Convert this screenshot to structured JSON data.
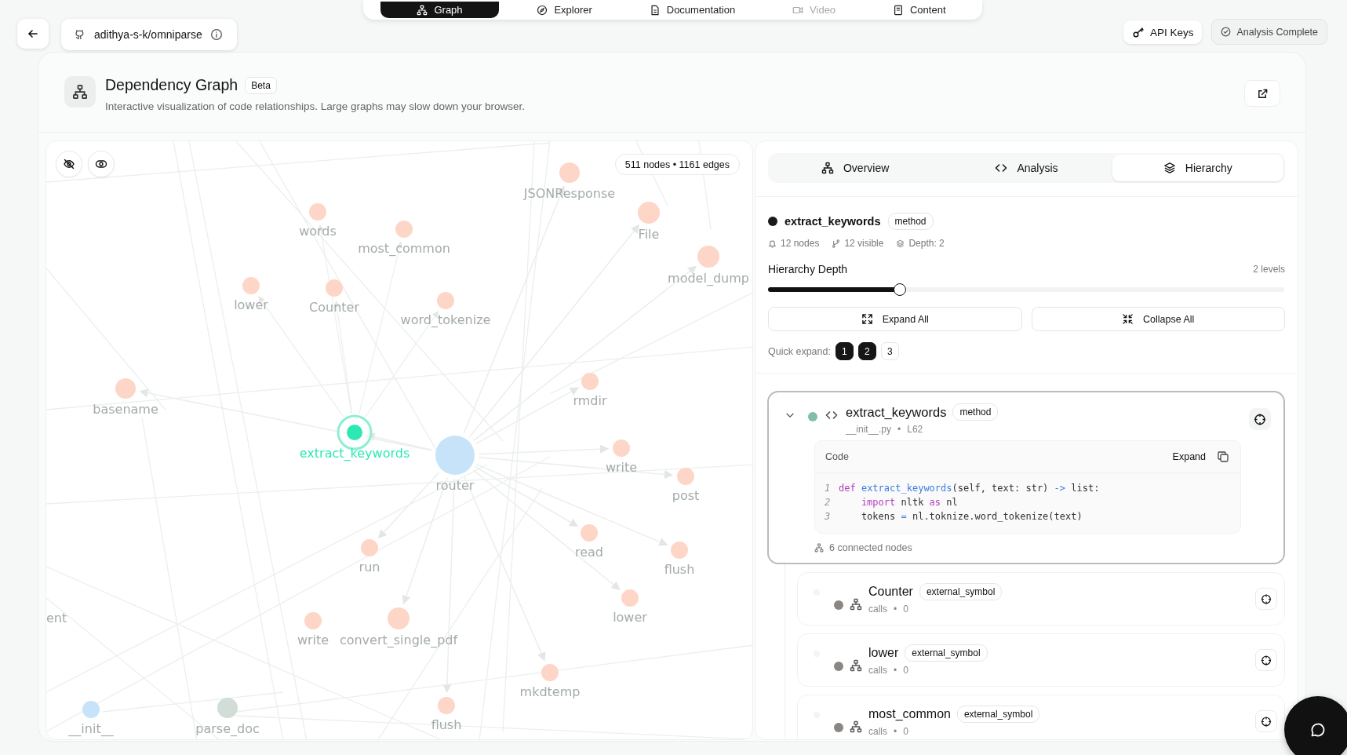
{
  "nav_tabs": [
    {
      "label": "Graph",
      "selected": true,
      "disabled": false
    },
    {
      "label": "Explorer",
      "selected": false,
      "disabled": false
    },
    {
      "label": "Documentation",
      "selected": false,
      "disabled": false
    },
    {
      "label": "Video",
      "selected": false,
      "disabled": true
    },
    {
      "label": "Content",
      "selected": false,
      "disabled": false
    }
  ],
  "repo": {
    "name": "adithya-s-k/omniparse"
  },
  "header_actions": [
    {
      "label": "API Keys",
      "kind": "key"
    },
    {
      "label": "Analysis Complete",
      "kind": "status"
    }
  ],
  "page": {
    "title": "Dependency Graph",
    "badge": "Beta",
    "subtitle": "Interactive visualization of code relationships. Large graphs may slow down your browser."
  },
  "graph": {
    "stats": "511 nodes • 1161 edges",
    "nodes": [
      {
        "label": "JSONResponse",
        "kind": "external"
      },
      {
        "label": "words",
        "kind": "external"
      },
      {
        "label": "most_common",
        "kind": "external"
      },
      {
        "label": "File",
        "kind": "external"
      },
      {
        "label": "model_dump",
        "kind": "external"
      },
      {
        "label": "lower",
        "kind": "external"
      },
      {
        "label": "Counter",
        "kind": "external"
      },
      {
        "label": "word_tokenize",
        "kind": "external"
      },
      {
        "label": "basename",
        "kind": "external"
      },
      {
        "label": "rmdir",
        "kind": "external"
      },
      {
        "label": "extract_keywords",
        "kind": "selected"
      },
      {
        "label": "router",
        "kind": "module"
      },
      {
        "label": "write",
        "kind": "external"
      },
      {
        "label": "post",
        "kind": "external"
      },
      {
        "label": "read",
        "kind": "external"
      },
      {
        "label": "flush",
        "kind": "external"
      },
      {
        "label": "lower",
        "kind": "external"
      },
      {
        "label": "run",
        "kind": "external"
      },
      {
        "label": "write",
        "kind": "external"
      },
      {
        "label": "convert_single_pdf",
        "kind": "external"
      },
      {
        "label": "mkdtemp",
        "kind": "external"
      },
      {
        "label": "flush",
        "kind": "external"
      },
      {
        "label": "__init__",
        "kind": "module"
      },
      {
        "label": "parse_doc",
        "kind": "function"
      },
      {
        "label": "ent",
        "kind": "label-only"
      }
    ]
  },
  "panel": {
    "tabs": [
      {
        "label": "Overview",
        "selected": false
      },
      {
        "label": "Analysis",
        "selected": false
      },
      {
        "label": "Hierarchy",
        "selected": true
      }
    ],
    "selected_node": {
      "name": "extract_keywords",
      "type": "method",
      "color": "#1a1a1a"
    },
    "stats": [
      "12 nodes",
      "12 visible",
      "Depth: 2"
    ],
    "depth": {
      "label": "Hierarchy Depth",
      "reading": "2 levels",
      "level": 0.255
    },
    "buttons": [
      "Expand All",
      "Collapse All"
    ],
    "quick_expand": {
      "label": "Quick expand:",
      "options": [
        {
          "label": "1",
          "selected": true
        },
        {
          "label": "2",
          "selected": true
        },
        {
          "label": "3",
          "selected": false
        }
      ]
    },
    "tree": {
      "name": "extract_keywords",
      "type": "method",
      "color": "#7fbfa7",
      "expanded": true,
      "file": "__init__.py",
      "line": "L62",
      "code_title": "Code",
      "code_action": "Expand",
      "separator": "•",
      "code": [
        {
          "num": "1",
          "tokens": [
            {
              "text": "def",
              "kind": "keyword"
            },
            {
              "text": " extract_keywords",
              "kind": "function"
            },
            {
              "text": "(self, text: str) ",
              "kind": "plain"
            },
            {
              "text": "->",
              "kind": "operator"
            },
            {
              "text": " list:",
              "kind": "plain"
            }
          ]
        },
        {
          "num": "2",
          "tokens": [
            {
              "text": "    import",
              "kind": "keyword"
            },
            {
              "text": " nltk ",
              "kind": "plain"
            },
            {
              "text": "as",
              "kind": "keyword"
            },
            {
              "text": " nl",
              "kind": "plain"
            }
          ]
        },
        {
          "num": "3",
          "tokens": [
            {
              "text": "    tokens ",
              "kind": "plain"
            },
            {
              "text": "=",
              "kind": "operator"
            },
            {
              "text": " nl.toknize.word_tokenize(text)",
              "kind": "plain"
            }
          ]
        }
      ],
      "connected": "6 connected nodes",
      "children": [
        {
          "name": "Counter",
          "type": "external_symbol",
          "color": "#8a8682",
          "relation": "calls",
          "separator": "•",
          "count": "0"
        },
        {
          "name": "lower",
          "type": "external_symbol",
          "color": "#8a8682",
          "relation": "calls",
          "separator": "•",
          "count": "0"
        },
        {
          "name": "most_common",
          "type": "external_symbol",
          "color": "#8a8682",
          "relation": "calls",
          "separator": "•",
          "count": "0"
        }
      ]
    }
  }
}
